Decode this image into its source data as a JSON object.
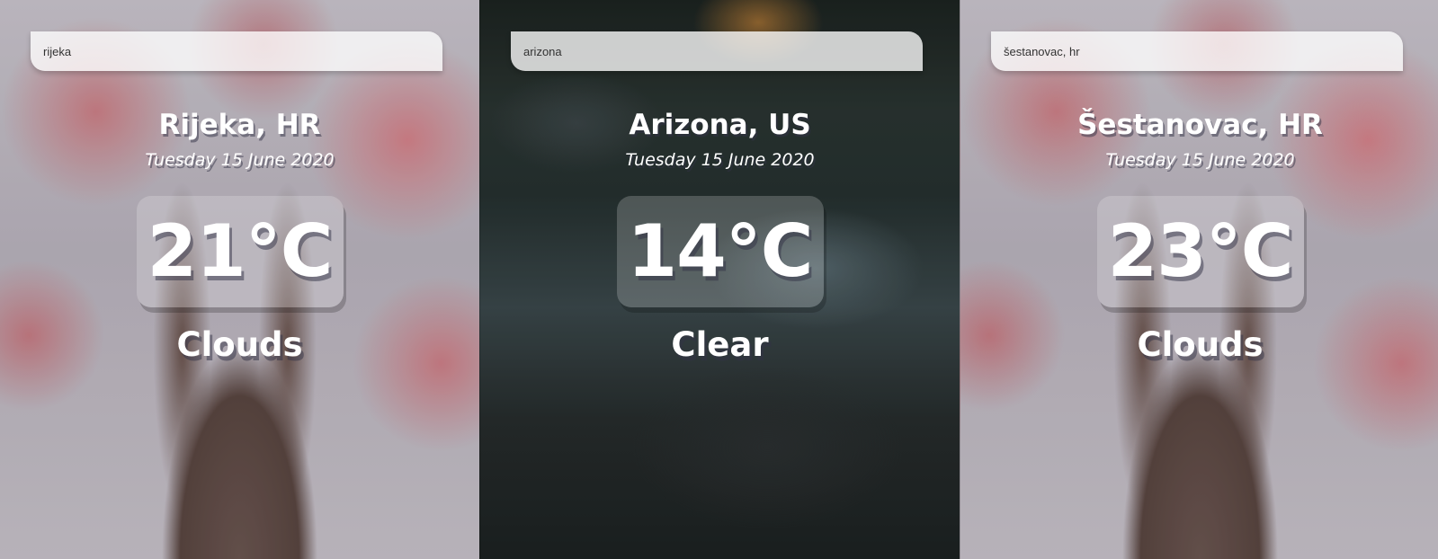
{
  "panels": [
    {
      "search_value": "rijeka",
      "location": "Rijeka, HR",
      "date": "Tuesday 15 June 2020",
      "temperature": "21°C",
      "condition": "Clouds",
      "background": "cherry-tree"
    },
    {
      "search_value": "arizona",
      "location": "Arizona, US",
      "date": "Tuesday 15 June 2020",
      "temperature": "14°C",
      "condition": "Clear",
      "background": "lake-forest"
    },
    {
      "search_value": "šestanovac, hr",
      "location": "Šestanovac, HR",
      "date": "Tuesday 15 June 2020",
      "temperature": "23°C",
      "condition": "Clouds",
      "background": "cherry-tree"
    }
  ],
  "colors": {
    "text": "#ffffff",
    "search_bg": "#ffffffc7",
    "temp_box_bg": "#ffffff33"
  }
}
